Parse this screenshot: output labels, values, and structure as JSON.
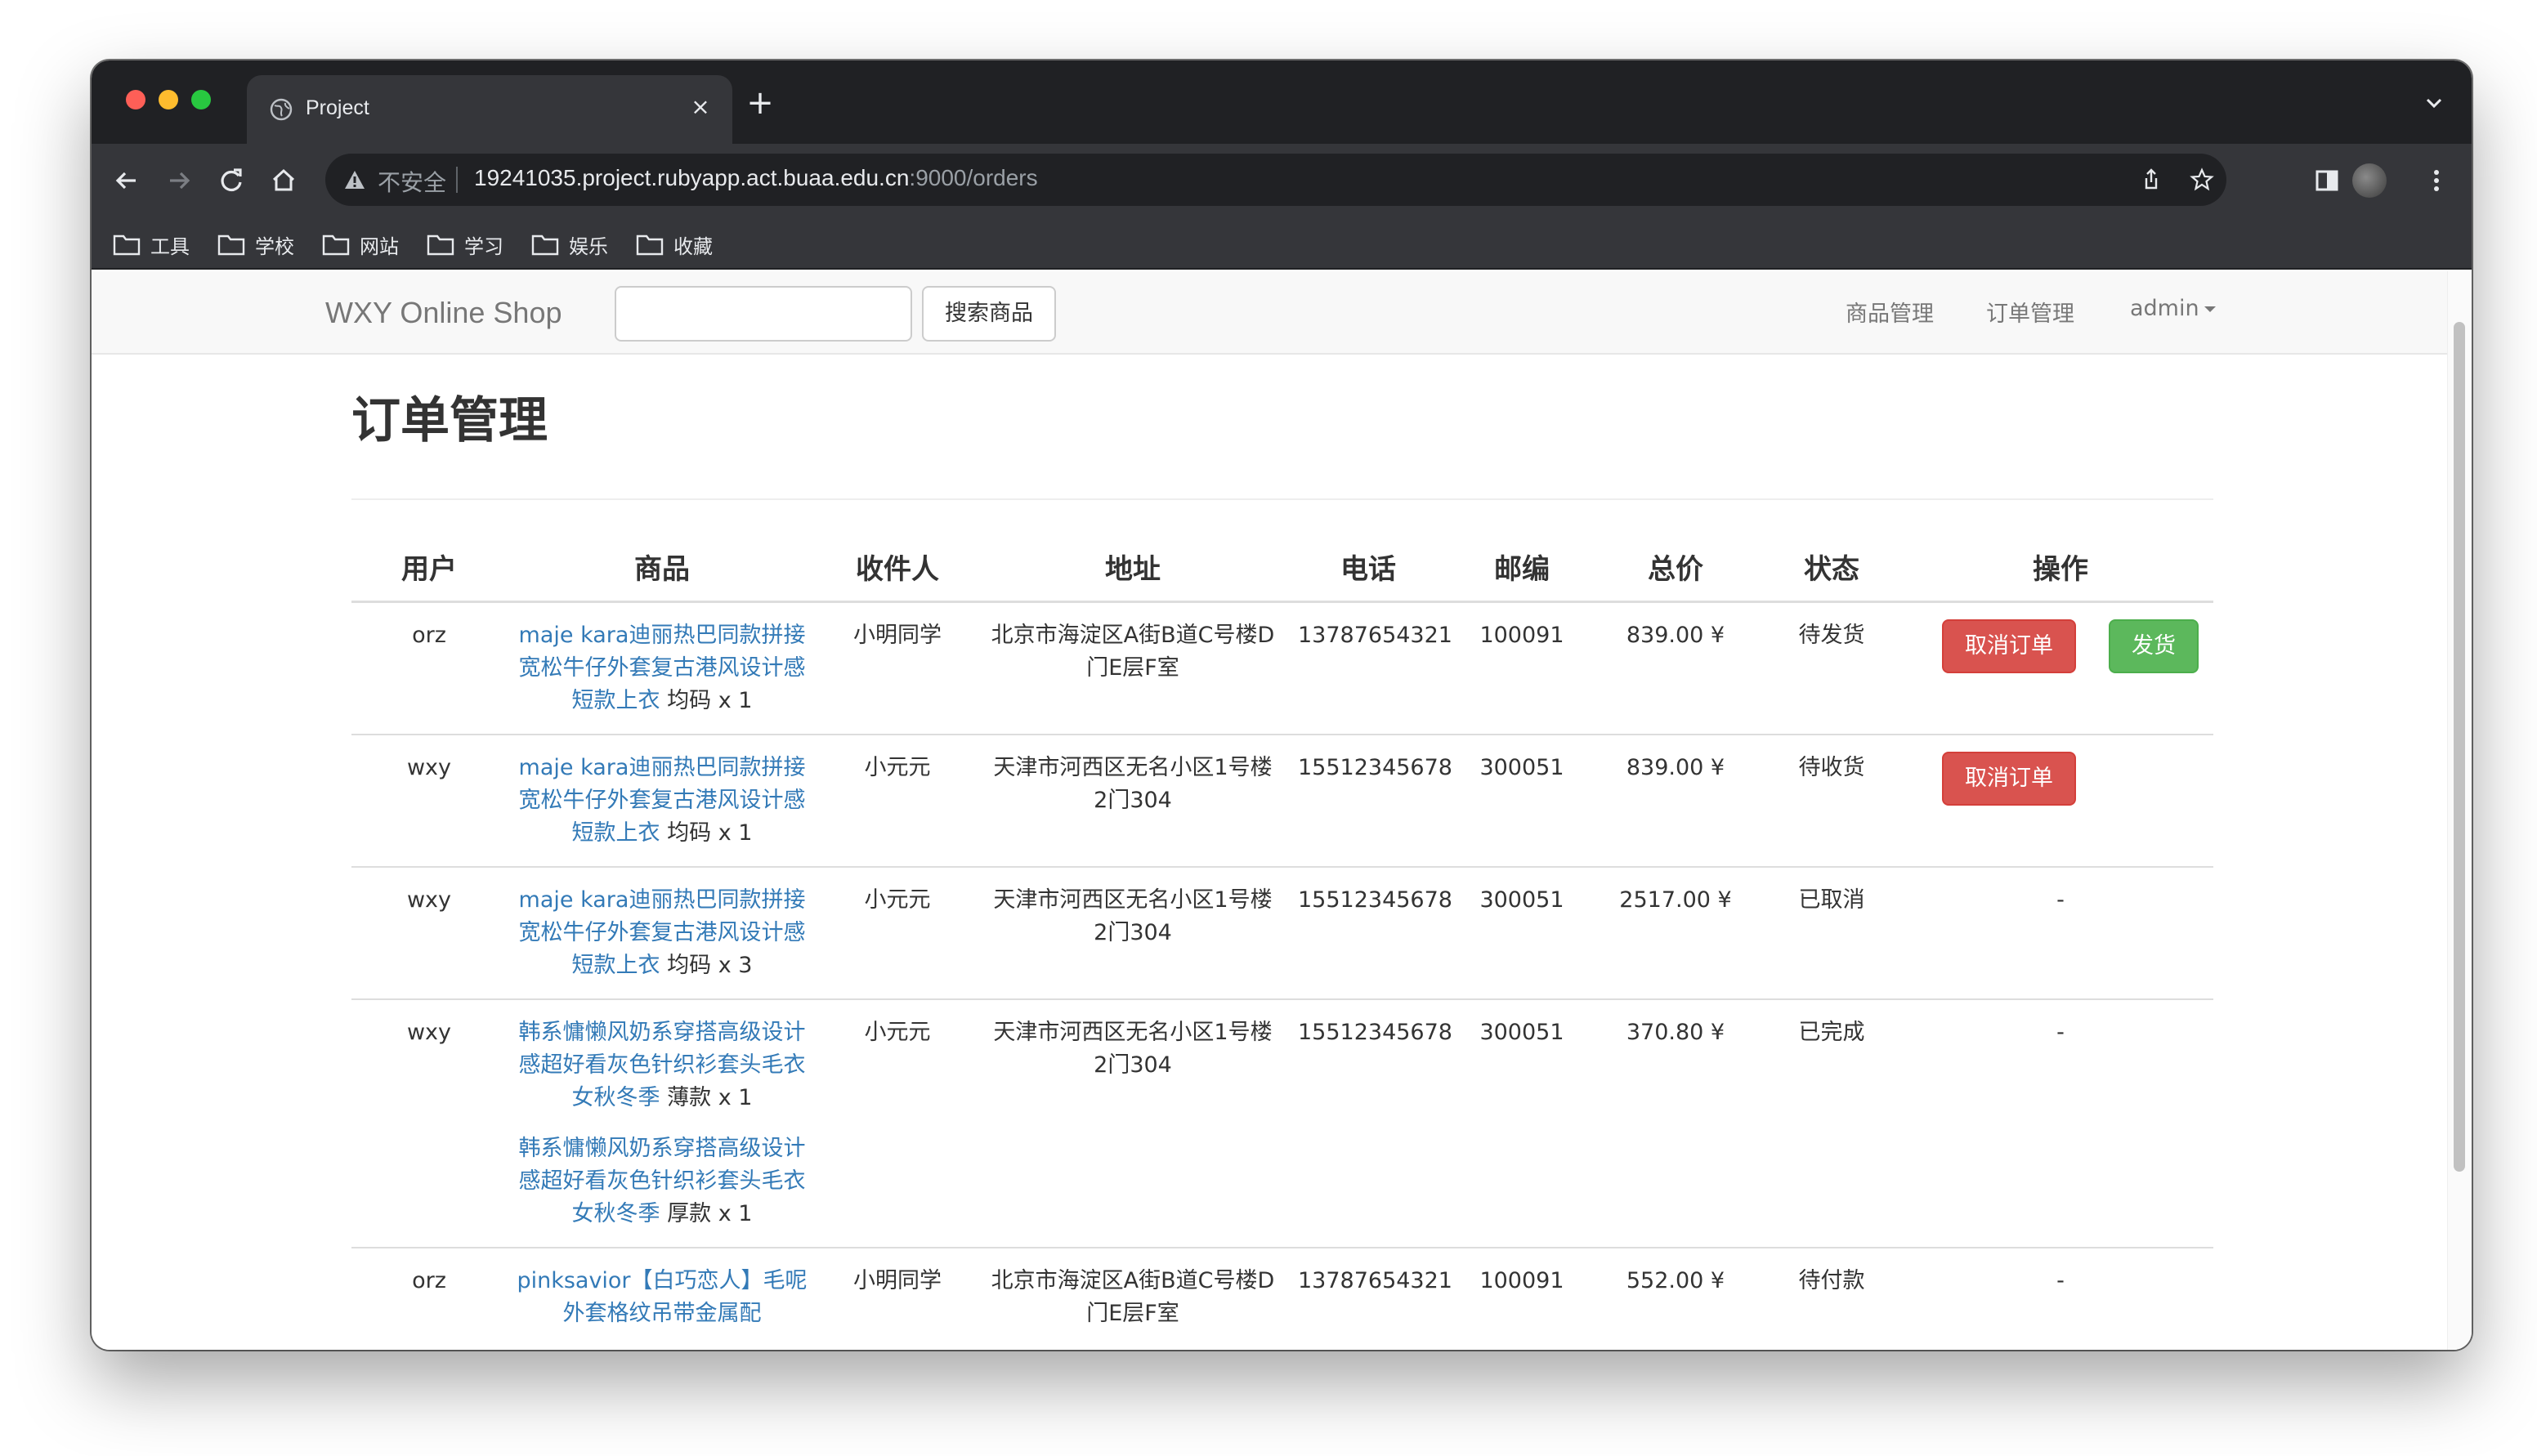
{
  "browser": {
    "tab_title": "Project",
    "close_glyph": "×",
    "new_tab_glyph": "+",
    "insecure_label": "不安全",
    "url_main": "19241035.project.rubyapp.act.buaa.edu.cn",
    "url_rest": ":9000/orders",
    "bookmarks": [
      "工具",
      "学校",
      "网站",
      "学习",
      "娱乐",
      "收藏"
    ]
  },
  "navbar": {
    "brand": "WXY Online Shop",
    "search_placeholder": "",
    "search_button": "搜索商品",
    "links": [
      "商品管理",
      "订单管理"
    ],
    "user_menu": "admin"
  },
  "page": {
    "title": "订单管理"
  },
  "table": {
    "headers": [
      "用户",
      "商品",
      "收件人",
      "地址",
      "电话",
      "邮编",
      "总价",
      "状态",
      "操作"
    ],
    "rows": [
      {
        "user": "orz",
        "products": [
          {
            "name": "maje kara迪丽热巴同款拼接宽松牛仔外套复古港风设计感短款上衣",
            "detail": " 均码 x 1"
          }
        ],
        "recipient": "小明同学",
        "address": "北京市海淀区A街B道C号楼D门E层F室",
        "phone": "13787654321",
        "zip": "100091",
        "total": "839.00 ¥",
        "status": "待发货",
        "actions": [
          "取消订单",
          "发货"
        ],
        "placeholder": ""
      },
      {
        "user": "wxy",
        "products": [
          {
            "name": "maje kara迪丽热巴同款拼接宽松牛仔外套复古港风设计感短款上衣",
            "detail": " 均码 x 1"
          }
        ],
        "recipient": "小元元",
        "address": "天津市河西区无名小区1号楼2门304",
        "phone": "15512345678",
        "zip": "300051",
        "total": "839.00 ¥",
        "status": "待收货",
        "actions": [
          "取消订单"
        ],
        "placeholder": ""
      },
      {
        "user": "wxy",
        "products": [
          {
            "name": "maje kara迪丽热巴同款拼接宽松牛仔外套复古港风设计感短款上衣",
            "detail": " 均码 x 3"
          }
        ],
        "recipient": "小元元",
        "address": "天津市河西区无名小区1号楼2门304",
        "phone": "15512345678",
        "zip": "300051",
        "total": "2517.00 ¥",
        "status": "已取消",
        "actions": [],
        "placeholder": "-"
      },
      {
        "user": "wxy",
        "products": [
          {
            "name": "韩系慵懒风奶系穿搭高级设计感超好看灰色针织衫套头毛衣女秋冬季",
            "detail": " 薄款 x 1"
          },
          {
            "name": "韩系慵懒风奶系穿搭高级设计感超好看灰色针织衫套头毛衣女秋冬季",
            "detail": " 厚款 x 1"
          }
        ],
        "recipient": "小元元",
        "address": "天津市河西区无名小区1号楼2门304",
        "phone": "15512345678",
        "zip": "300051",
        "total": "370.80 ¥",
        "status": "已完成",
        "actions": [],
        "placeholder": "-"
      },
      {
        "user": "orz",
        "products": [
          {
            "name": "pinksavior【白巧恋人】毛呢外套格纹吊带金属配",
            "detail": ""
          }
        ],
        "recipient": "小明同学",
        "address": "北京市海淀区A街B道C号楼D门E层F室",
        "phone": "13787654321",
        "zip": "100091",
        "total": "552.00 ¥",
        "status": "待付款",
        "actions": [],
        "placeholder": "-"
      }
    ]
  },
  "colors": {
    "link": "#337ab7",
    "price": "#a94442",
    "danger": "#d9534f",
    "success": "#5cb85c",
    "chrome_dark": "#202124",
    "chrome_mid": "#35363a"
  }
}
